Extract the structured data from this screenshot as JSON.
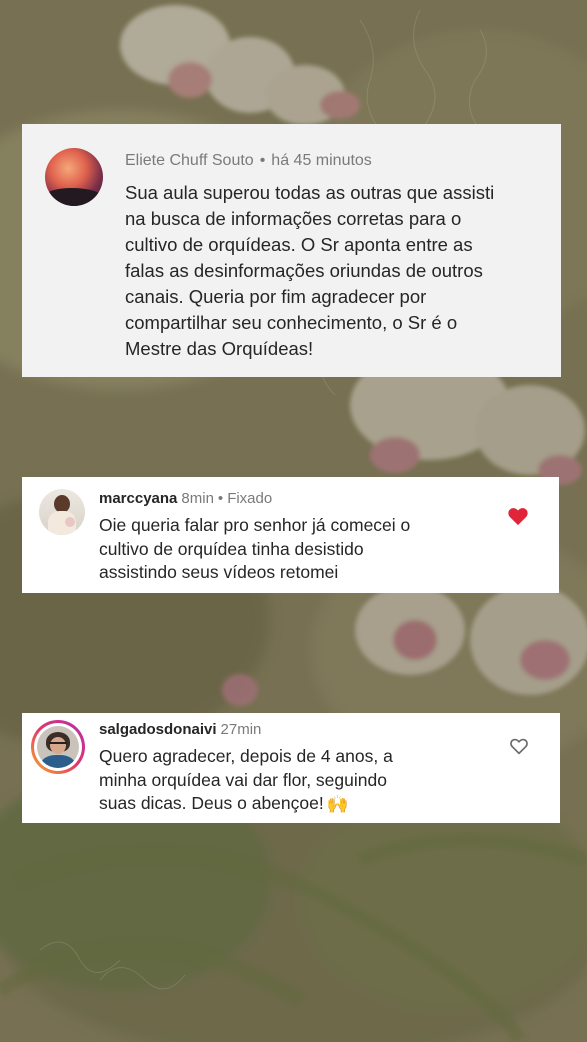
{
  "comments": [
    {
      "username": "Eliete Chuff Souto",
      "separator": "•",
      "time": "há 45 minutos",
      "text": "Sua aula superou todas as outras que assisti\nna busca de informações corretas para o\ncultivo de orquídeas. O Sr aponta entre as\nfalas as desinformações oriundas de outros\ncanais. Queria por fim agradecer por\ncompartilhar seu conhecimento, o Sr é o\nMestre das Orquídeas!",
      "avatar_icon": "sunset-photo-avatar"
    },
    {
      "username": "marccyana",
      "time": "8min",
      "separator": "•",
      "status": "Fixado",
      "text": "Oie queria falar pro senhor já comecei o\ncultivo de orquídea tinha desistido\nassistindo seus vídeos retomei",
      "liked": true,
      "heart_color": "#e0243a",
      "heart_icon": "heart-filled-icon",
      "avatar_icon": "woman-photo-avatar"
    },
    {
      "username": "salgadosdonaivi",
      "time": "27min",
      "text": "Quero agradecer, depois de 4 anos, a\nminha orquídea vai dar flor, seguindo\nsuas dicas. Deus o abençoe!",
      "emoji": "🙌",
      "liked": false,
      "heart_icon": "heart-outline-icon",
      "avatar_icon": "story-ring-avatar"
    }
  ]
}
